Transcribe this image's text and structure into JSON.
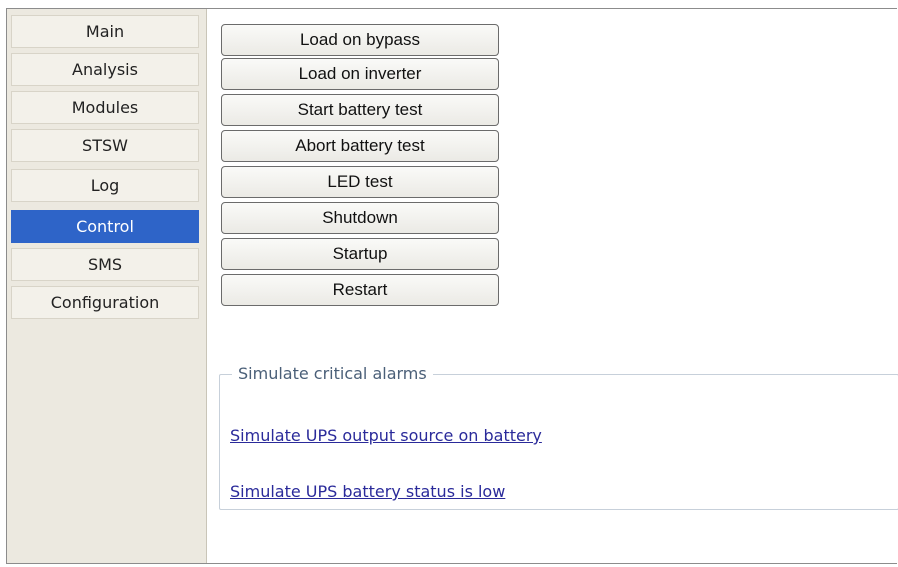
{
  "sidebar": {
    "items": [
      {
        "label": "Main"
      },
      {
        "label": "Analysis"
      },
      {
        "label": "Modules"
      },
      {
        "label": "STSW"
      },
      {
        "label": "Log"
      },
      {
        "label": "Control",
        "active": true
      },
      {
        "label": "SMS"
      },
      {
        "label": "Configuration"
      }
    ]
  },
  "control": {
    "buttons": [
      "Load on bypass",
      "Load on inverter",
      "Start battery test",
      "Abort battery test",
      "LED test",
      "Shutdown",
      "Startup",
      "Restart"
    ],
    "alarms": {
      "legend": "Simulate critical alarms",
      "links": [
        "Simulate UPS output source on battery",
        "Simulate UPS battery status is low"
      ]
    }
  },
  "colors": {
    "active_nav_bg": "#2e64c8",
    "link": "#2a2a9a"
  }
}
